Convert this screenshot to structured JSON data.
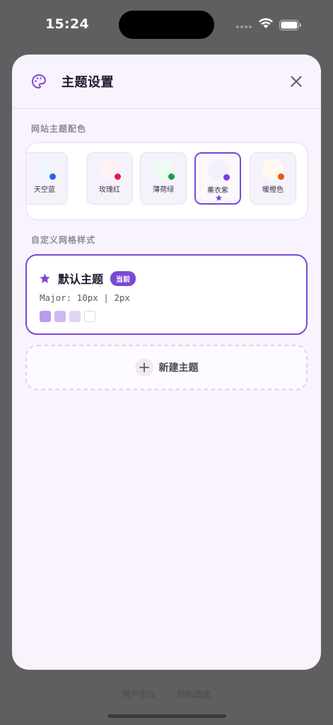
{
  "status_bar": {
    "time": "15:24"
  },
  "modal": {
    "title": "主题设置",
    "accent_color": "#7b48d6",
    "section_site_colors": "网站主题配色",
    "swatches": [
      {
        "label": "天空蓝",
        "color": "#eef5fd",
        "dot": "#2563eb",
        "active": false
      },
      {
        "label": "玫瑰红",
        "color": "#fdf3f5",
        "dot": "#e11d48",
        "active": false
      },
      {
        "label": "薄荷绿",
        "color": "#edfbf1",
        "dot": "#16a34a",
        "active": false
      },
      {
        "label": "薰衣紫",
        "color": "#f5f1fb",
        "dot": "#7c3aed",
        "active": true
      },
      {
        "label": "暖橙色",
        "color": "#fff9ef",
        "dot": "#ea580c",
        "active": false
      }
    ],
    "section_custom_grid": "自定义网格样式",
    "theme_card": {
      "name": "默认主题",
      "badge": "当前",
      "meta": "Major: 10px | 2px",
      "chips": [
        "#b79bf0",
        "#cdb8f5",
        "#e1d5f9",
        "#ffffff"
      ]
    },
    "new_theme_label": "新建主题"
  },
  "background": {
    "links": [
      "用户协议",
      "隐私政策"
    ]
  }
}
